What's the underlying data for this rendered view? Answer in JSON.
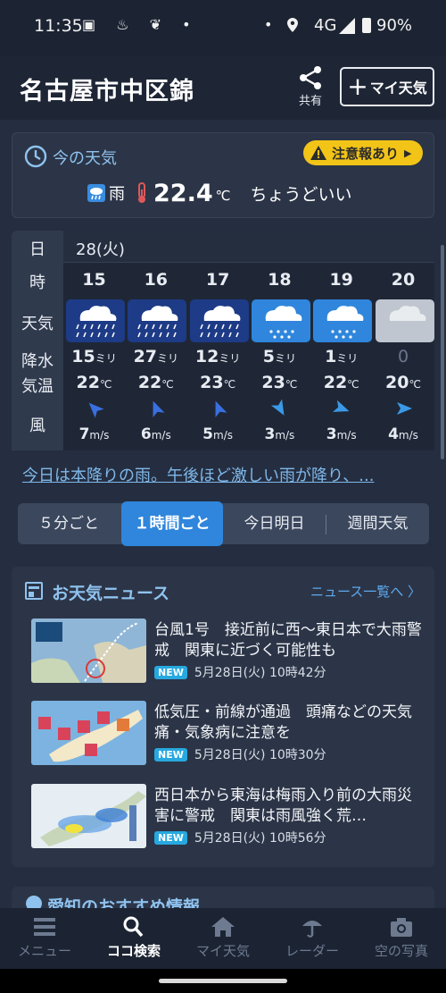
{
  "status_bar": {
    "time": "11:35",
    "network": "4G",
    "battery": "90%"
  },
  "header": {
    "title": "名古屋市中区錦",
    "share_label": "共有",
    "my_weather_label": "マイ天気"
  },
  "current": {
    "title": "今の天気",
    "alert": "注意報あり",
    "condition": "雨",
    "temperature": "22.4",
    "temp_unit": "℃",
    "feel": "ちょうどいい"
  },
  "hourly": {
    "row_labels": {
      "day": "日",
      "hour": "時",
      "weather": "天気",
      "precip": "降水",
      "temp": "気温",
      "wind": "風"
    },
    "day": "28(火)",
    "precip_unit": "ミリ",
    "temp_unit": "℃",
    "wind_unit": "m/s",
    "hours": [
      {
        "hour": "15",
        "weather": "heavy-rain-icon",
        "precip": "15",
        "temp": "22",
        "wind": "7",
        "wind_dir": "northwest"
      },
      {
        "hour": "16",
        "weather": "heavy-rain-icon",
        "precip": "27",
        "temp": "22",
        "wind": "6",
        "wind_dir": "north-northwest"
      },
      {
        "hour": "17",
        "weather": "heavy-rain-icon",
        "precip": "12",
        "temp": "23",
        "wind": "5",
        "wind_dir": "north-northwest"
      },
      {
        "hour": "18",
        "weather": "rain-icon",
        "precip": "5",
        "temp": "23",
        "wind": "3",
        "wind_dir": "south-southwest"
      },
      {
        "hour": "19",
        "weather": "rain-icon",
        "precip": "1",
        "temp": "22",
        "wind": "3",
        "wind_dir": "west-southwest"
      },
      {
        "hour": "20",
        "weather": "cloud-icon",
        "precip": "0",
        "temp": "20",
        "wind": "4",
        "wind_dir": "west"
      }
    ]
  },
  "summary": "今日は本降りの雨。午後ほど激しい雨が降り、...",
  "segments": [
    "５分ごと",
    "１時間ごと",
    "今日明日",
    "週間天気"
  ],
  "news": {
    "title": "お天気ニュース",
    "more": "ニュース一覧へ",
    "items": [
      {
        "headline": "台風1号　接近前に西～東日本で大雨警戒　関東に近づく可能性も",
        "badge": "NEW",
        "date": "5月28日(火) 10時42分"
      },
      {
        "headline": "低気圧・前線が通過　頭痛などの天気痛・気象病に注意を",
        "badge": "NEW",
        "date": "5月28日(火) 10時30分"
      },
      {
        "headline": "西日本から東海は梅雨入り前の大雨災害に警戒　関東は雨風強く荒…",
        "badge": "NEW",
        "date": "5月28日(火) 10時56分"
      }
    ]
  },
  "next_section": {
    "title": "愛知のおすすめ情報"
  },
  "bottom_nav": [
    {
      "label": "メニュー",
      "icon": "menu-icon"
    },
    {
      "label": "ココ検索",
      "icon": "search-icon"
    },
    {
      "label": "マイ天気",
      "icon": "home-icon"
    },
    {
      "label": "レーダー",
      "icon": "radar-icon"
    },
    {
      "label": "空の写真",
      "icon": "camera-icon"
    }
  ],
  "colors": {
    "accent": "#2f86dc",
    "link": "#7fb8ea",
    "alert": "#f2c417",
    "new_badge": "#27a9e0"
  }
}
